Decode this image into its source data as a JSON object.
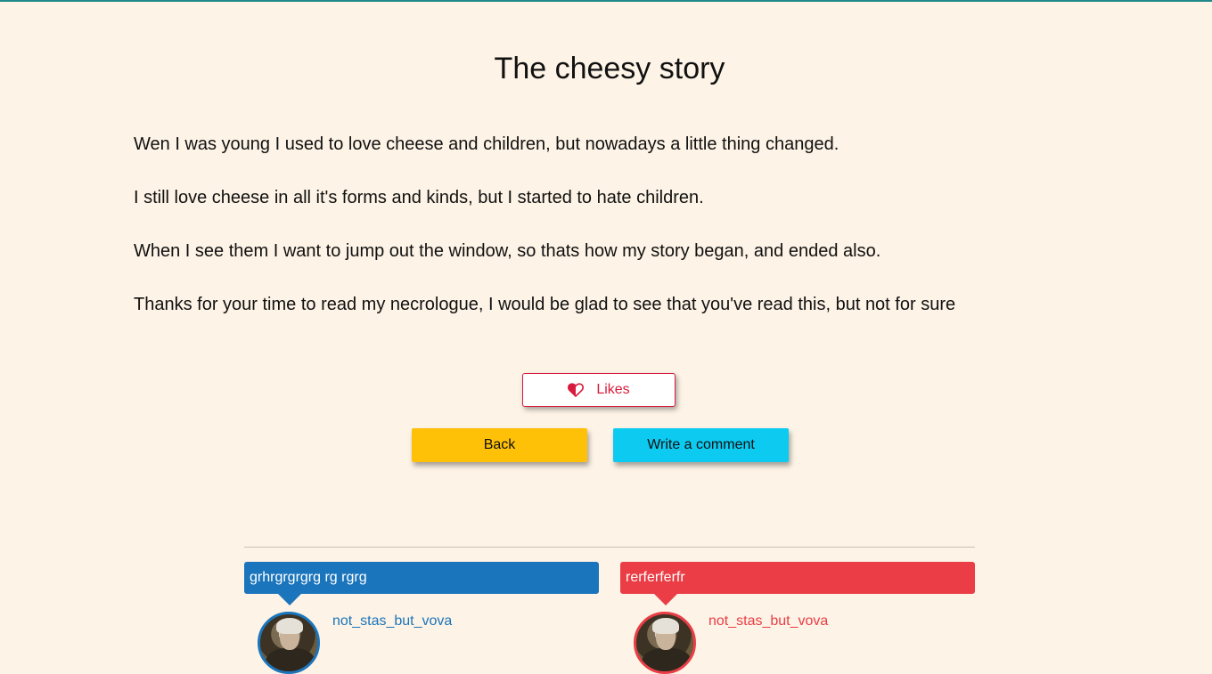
{
  "story": {
    "title": "The cheesy story",
    "paragraphs": [
      "Wen I was young I used to love cheese and children, but nowadays a little thing changed.",
      "I still love cheese in all it's forms and kinds, but I started to hate children.",
      "When I see them I want to jump out the window, so thats how my story began, and ended also.",
      "Thanks for your time to read my necrologue, I would be glad to see that you've read this, but not for sure"
    ]
  },
  "actions": {
    "likes_label": "Likes",
    "likes_icon": "half-heart-icon",
    "back_label": "Back",
    "comment_label": "Write a comment"
  },
  "comments": [
    {
      "text": "grhrgrgrgrg rg rgrg",
      "author": "not_stas_but_vova",
      "color": "#1b75bc"
    },
    {
      "text": "rerferferfr",
      "author": "not_stas_but_vova",
      "color": "#ea3d45"
    }
  ],
  "colors": {
    "background": "#fdf3e6",
    "likes_accent": "#d81b3c",
    "back_button": "#ffc107",
    "comment_button": "#0dcaf0"
  }
}
